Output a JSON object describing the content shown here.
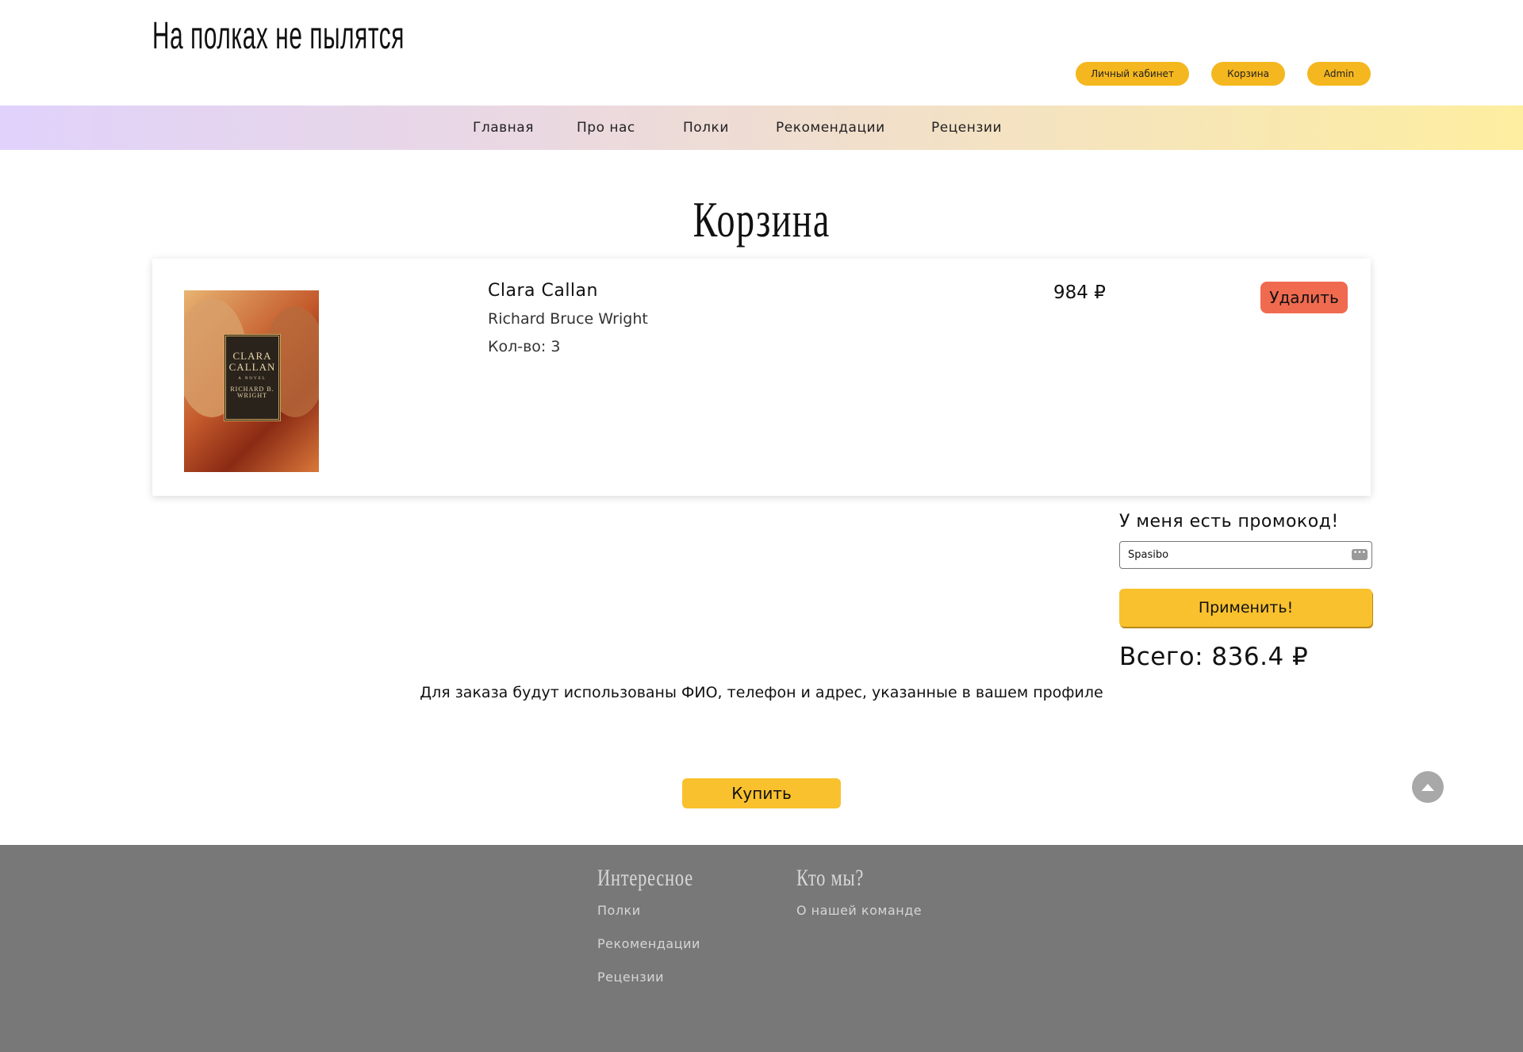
{
  "header": {
    "site_title": "На полках не пылятся",
    "buttons": {
      "cabinet": "Личный кабинет",
      "cart": "Корзина",
      "admin": "Admin"
    }
  },
  "nav": {
    "items": [
      "Главная",
      "Про нас",
      "Полки",
      "Рекомендации",
      "Рецензии"
    ]
  },
  "page": {
    "title": "Корзина"
  },
  "cart": {
    "items": [
      {
        "title": "Clara Callan",
        "author": "Richard Bruce Wright",
        "quantity_label": "Кол-во: 3",
        "price": "984 ₽",
        "delete_label": "Удалить",
        "cover": {
          "title_line1": "CLARA",
          "title_line2": "CALLAN",
          "subtitle": "A NOVEL",
          "author_line1": "RICHARD B.",
          "author_line2": "WRIGHT"
        }
      }
    ]
  },
  "promo": {
    "title": "У меня есть промокод!",
    "input_value": "Spasibo",
    "apply_label": "Применить!"
  },
  "total": {
    "label": "Всего: 836.4 ₽"
  },
  "order_note": "Для заказа будут использованы ФИО, телефон и адрес, указанные в вашем профиле",
  "buy_label": "Купить",
  "footer": {
    "col1": {
      "heading": "Интересное",
      "links": [
        "Полки",
        "Рекомендации",
        "Рецензии"
      ]
    },
    "col2": {
      "heading": "Кто мы?",
      "links": [
        "О нашей команде"
      ]
    }
  },
  "colors": {
    "accent_yellow": "#f9c12e",
    "delete_red": "#f06a50",
    "footer_bg": "#787878"
  }
}
